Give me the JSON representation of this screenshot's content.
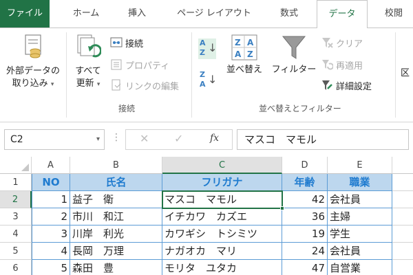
{
  "tabs": [
    {
      "label": "ファイル",
      "active": false
    },
    {
      "label": "ホーム",
      "active": false
    },
    {
      "label": "挿入",
      "active": false
    },
    {
      "label": "ページ レイアウト",
      "active": false
    },
    {
      "label": "数式",
      "active": false
    },
    {
      "label": "データ",
      "active": true
    },
    {
      "label": "校閲",
      "active": false
    }
  ],
  "ribbon": {
    "external_data": {
      "line1": "外部データの",
      "line2": "取り込み"
    },
    "refresh_all": {
      "line1": "すべて",
      "line2": "更新"
    },
    "connections": {
      "connect": "接続",
      "properties": "プロパティ",
      "edit_links": "リンクの編集",
      "group": "接続"
    },
    "sort_filter": {
      "sort": "並べ替え",
      "filter": "フィルター",
      "clear": "クリア",
      "reapply": "再適用",
      "advanced": "詳細設定",
      "group": "並べ替えとフィルター"
    },
    "cut_off_label": "区"
  },
  "formula_bar": {
    "name_box": "C2",
    "cancel": "✕",
    "enter": "✓",
    "fx": "fx",
    "value": "マスコ　マモル"
  },
  "grid": {
    "columns": [
      "A",
      "B",
      "C",
      "D",
      "E"
    ],
    "selected_column": "C",
    "rows": [
      {
        "num": "1",
        "cells": [
          "NO",
          "氏名",
          "フリガナ",
          "年齢",
          "職業"
        ],
        "header": true
      },
      {
        "num": "2",
        "cells": [
          "1",
          "益子　衛",
          "マスコ　マモル",
          "42",
          "会社員"
        ]
      },
      {
        "num": "3",
        "cells": [
          "2",
          "市川　和江",
          "イチカワ　カズエ",
          "36",
          "主婦"
        ]
      },
      {
        "num": "4",
        "cells": [
          "3",
          "川岸　利光",
          "カワギシ　トシミツ",
          "19",
          "学生"
        ]
      },
      {
        "num": "5",
        "cells": [
          "4",
          "長岡　万理",
          "ナガオカ　マリ",
          "24",
          "会社員"
        ]
      },
      {
        "num": "6",
        "cells": [
          "5",
          "森田　豊",
          "モリタ　ユタカ",
          "47",
          "自営業"
        ]
      }
    ],
    "selected_row": "2",
    "accent": "#217346",
    "header_fill": "#bdd7ee"
  }
}
